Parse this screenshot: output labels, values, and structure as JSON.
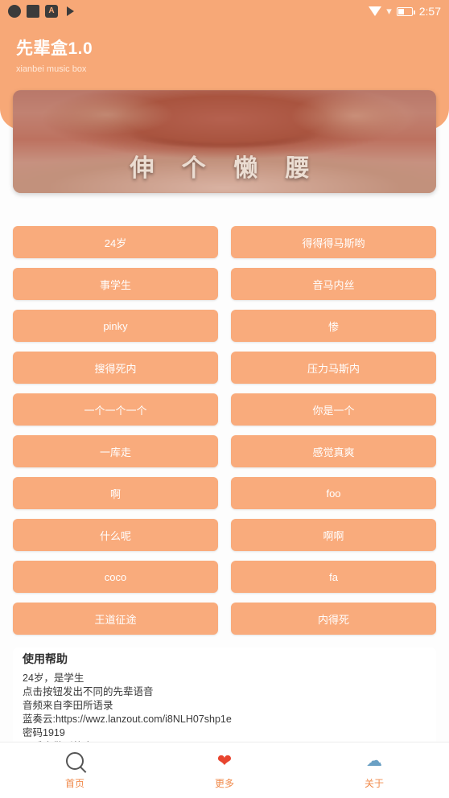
{
  "statusbar": {
    "icons_left": [
      "record-circle-icon",
      "stop-square-icon",
      "a-badge-icon",
      "play-icon"
    ],
    "a_badge": "A",
    "signal": "▾",
    "time": "2:57"
  },
  "header": {
    "title": "先辈盒1.0",
    "subtitle": "xianbei music box"
  },
  "banner": {
    "caption": "伸 个 懒 腰",
    "alt_name": "meme-banner-image"
  },
  "buttons": [
    "24岁",
    "得得得马斯哟",
    "事学生",
    "音马内丝",
    "pinky",
    "惨",
    "搜得死内",
    "压力马斯内",
    "一个一个一个",
    "你是一个",
    "一库走",
    "感觉真爽",
    "啊",
    "foo",
    "什么呢",
    "啊啊",
    "coco",
    "fa",
    "王道征途",
    "内得死"
  ],
  "help": {
    "title": "使用帮助",
    "lines": [
      "24岁，是学生",
      "点击按钮发出不同的先辈语音",
      "音频来自李田所语录",
      "蓝奏云:https://wwz.lanzout.com/i8NLH07shp1e",
      "密码1919",
      "以后会做别的盒"
    ]
  },
  "bottom_nav": [
    {
      "icon": "search-icon",
      "label": "首页"
    },
    {
      "icon": "heart-icon",
      "label": "更多"
    },
    {
      "icon": "about-icon",
      "label": "关于"
    }
  ],
  "colors": {
    "accent": "#f7a877",
    "button": "#f9ab7c",
    "nav_label": "#f08a4b"
  }
}
